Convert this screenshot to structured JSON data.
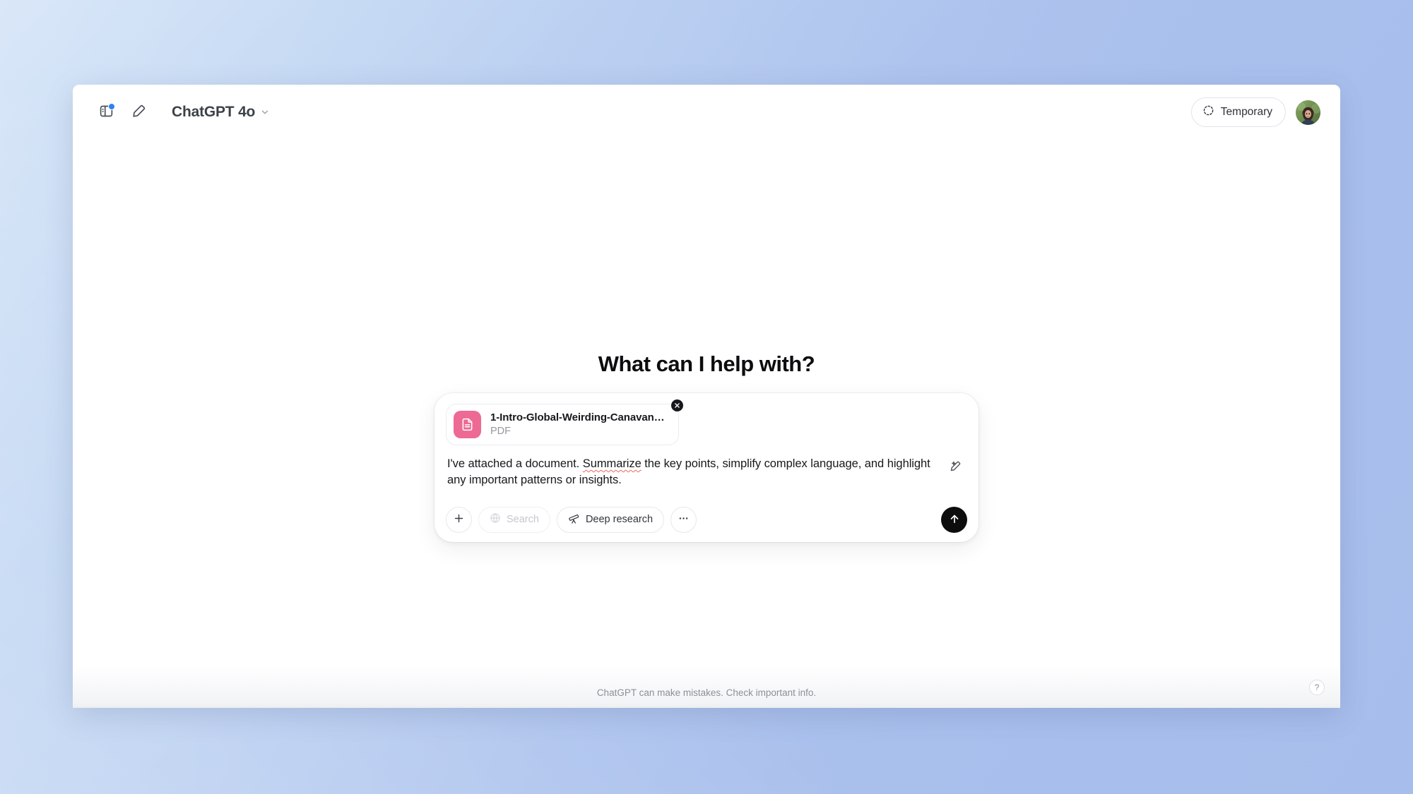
{
  "window": {
    "header": {
      "sidebar_toggle_icon": "sidebar-panel-icon",
      "has_notification_dot": true,
      "new_chat_icon": "compose-pencil-icon",
      "model_name": "ChatGPT 4o",
      "model_chevron_icon": "chevron-down-icon",
      "temporary_label": "Temporary",
      "temporary_icon": "dashed-circle-icon",
      "avatar_name": "user-avatar"
    },
    "main": {
      "greeting": "What can I help with?",
      "composer": {
        "attachment": {
          "file_name": "1-Intro-Global-Weirding-Canavan-H…",
          "file_type": "PDF",
          "file_icon": "pdf-document-icon",
          "accent_color": "#ec6a93",
          "remove_icon": "close-x-icon"
        },
        "prompt": {
          "text_before": "I've attached a document. ",
          "misspelled_word": "Summarize",
          "text_after": " the key points, simplify complex language, and highlight any important patterns or insights.",
          "spellcheck_color": "#e8685f"
        },
        "enhance_icon": "magic-pencil-icon",
        "tools": {
          "add_label": "+",
          "add_icon": "plus-icon",
          "search_label": "Search",
          "search_icon": "globe-icon",
          "search_disabled": true,
          "deep_research_label": "Deep research",
          "deep_research_icon": "telescope-icon",
          "more_icon": "ellipsis-icon"
        },
        "send_icon": "arrow-up-icon",
        "send_bg": "#0d0d0d"
      }
    },
    "footer": {
      "disclaimer": "ChatGPT can make mistakes. Check important info.",
      "help_label": "?",
      "help_icon": "question-mark-icon"
    }
  }
}
